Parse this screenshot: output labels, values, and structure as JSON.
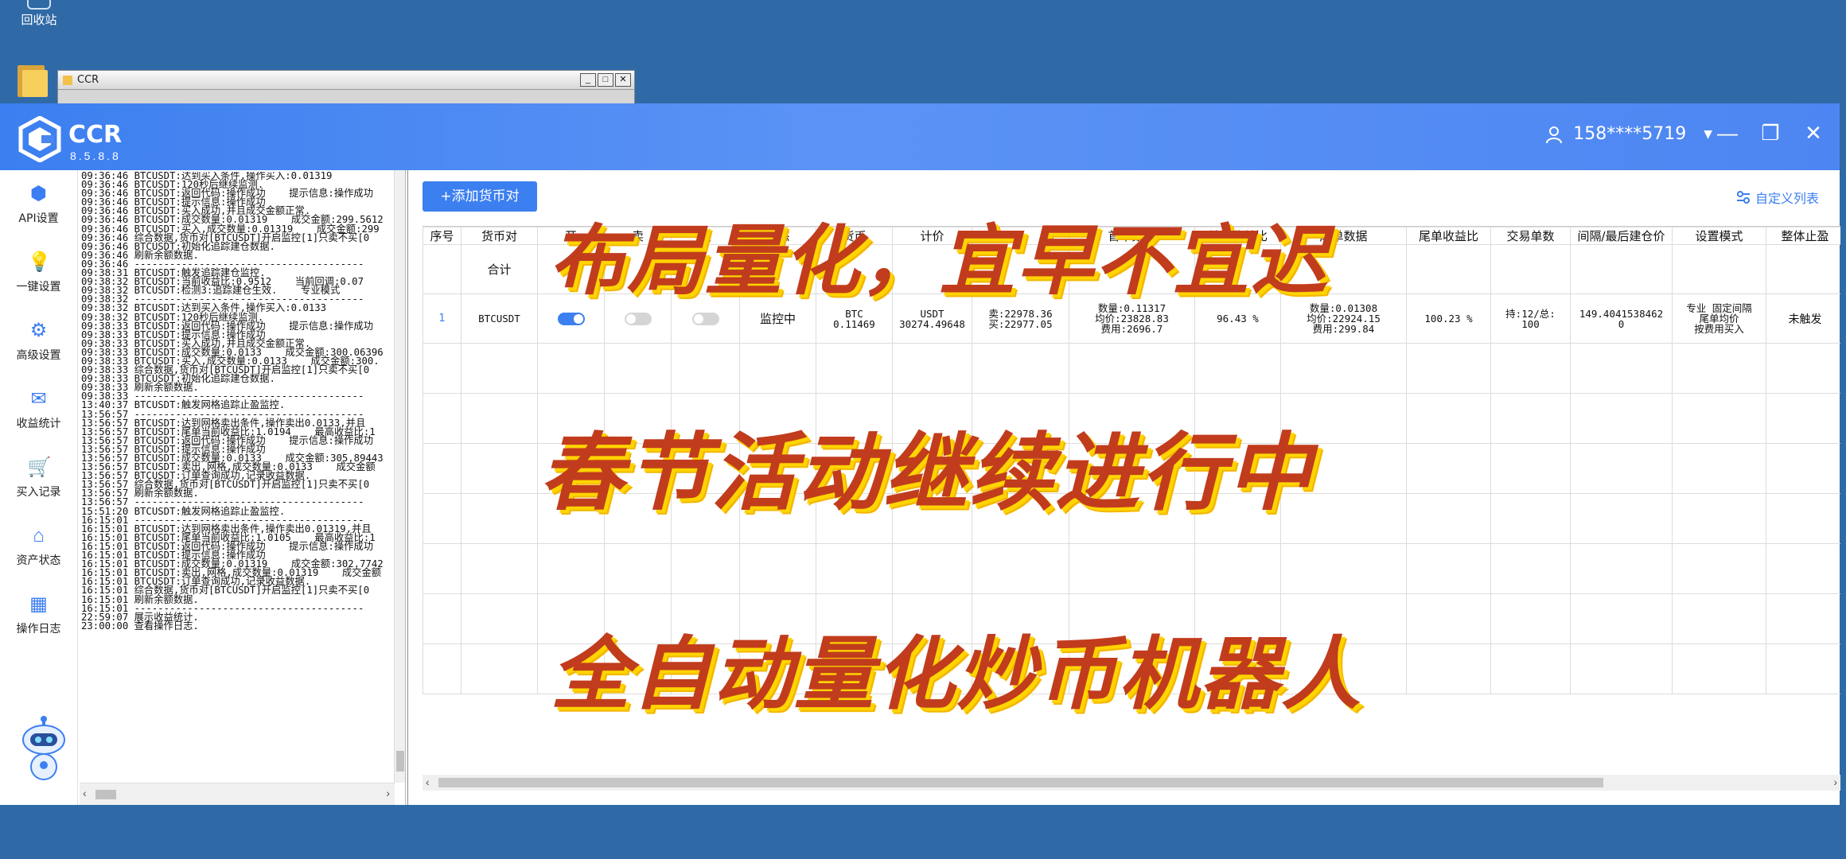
{
  "desktop": {
    "recycle_bin_label": "回收站",
    "bg_window_title": "CCR"
  },
  "app": {
    "name": "CCR",
    "version": "8.5.8.8",
    "user": "158****5719"
  },
  "sidebar": {
    "items": [
      {
        "label": "API设置",
        "icon": "shield-icon"
      },
      {
        "label": "一键设置",
        "icon": "bulb-icon"
      },
      {
        "label": "高级设置",
        "icon": "gear-icon"
      },
      {
        "label": "收益统计",
        "icon": "envelope-icon"
      },
      {
        "label": "买入记录",
        "icon": "cart-icon"
      },
      {
        "label": "资产状态",
        "icon": "home-icon"
      },
      {
        "label": "操作日志",
        "icon": "log-icon"
      }
    ]
  },
  "log_lines": [
    "09:36:46 BTCUSDT:达到买入条件,操作买入:0.01319",
    "09:36:46 BTCUSDT:120秒后继续监测.",
    "09:36:46 BTCUSDT:返回代码:操作成功    提示信息:操作成功",
    "09:36:46 BTCUSDT:提示信息:操作成功",
    "09:36:46 BTCUSDT:买入成功,并且成交金额正常.",
    "09:36:46 BTCUSDT:成交数量:0.01319    成交金额:299.5612",
    "09:36:46 BTCUSDT:买入,成交数量:0.01319    成交金额:299",
    "09:36:46 综合数据,货币对[BTCUSDT]开启监控[1]只卖不买[0",
    "09:36:46 BTCUSDT:初始化追踪建仓数据.",
    "09:36:46 刷新余额数据.",
    "09:36:46 ---------------------------------------",
    "09:38:31 BTCUSDT:触发追踪建仓监控.",
    "09:38:32 BTCUSDT:当前收益比:0.9512    当前回调:0.07",
    "09:38:32 BTCUSDT:检测3:追踪建仓生效.    专业模式",
    "09:38:32 ---------------------------------------",
    "09:38:32 BTCUSDT:达到买入条件,操作买入:0.0133",
    "09:38:32 BTCUSDT:120秒后继续监测.",
    "09:38:33 BTCUSDT:返回代码:操作成功    提示信息:操作成功",
    "09:38:33 BTCUSDT:提示信息:操作成功",
    "09:38:33 BTCUSDT:买入成功,并且成交金额正常.",
    "09:38:33 BTCUSDT:成交数量:0.0133    成交金额:300.06396",
    "09:38:33 BTCUSDT:买入,成交数量:0.0133    成交金额:300.",
    "09:38:33 综合数据,货币对[BTCUSDT]开启监控[1]只卖不买[0",
    "09:38:33 BTCUSDT:初始化追踪建仓数据.",
    "09:38:33 刷新余额数据.",
    "09:38:33 ---------------------------------------",
    "13:40:37 BTCUSDT:触发网格追踪止盈监控.",
    "13:56:57 ---------------------------------------",
    "13:56:57 BTCUSDT:达到网格卖出条件,操作卖出0.0133,并且",
    "13:56:57 BTCUSDT:尾单当前收益比:1.0194    最高收益比:1",
    "13:56:57 BTCUSDT:返回代码:操作成功    提示信息:操作成功",
    "13:56:57 BTCUSDT:提示信息:操作成功",
    "13:56:57 BTCUSDT:成交数量:0.0133    成交金额:305.89443",
    "13:56:57 BTCUSDT:卖出,网格,成交数量:0.0133    成交金额",
    "13:56:57 BTCUSDT:订单查询成功,记录收益数据.",
    "13:56:57 综合数据,货币对[BTCUSDT]开启监控[1]只卖不买[0",
    "13:56:57 刷新余额数据.",
    "13:56:57 ---------------------------------------",
    "15:51:20 BTCUSDT:触发网格追踪止盈监控.",
    "16:15:01 ---------------------------------------",
    "16:15:01 BTCUSDT:达到网格卖出条件,操作卖出0.01319,并且",
    "16:15:01 BTCUSDT:尾单当前收益比:1.0105    最高收益比:1",
    "16:15:01 BTCUSDT:返回代码:操作成功    提示信息:操作成功",
    "16:15:01 BTCUSDT:提示信息:操作成功",
    "16:15:01 BTCUSDT:成交数量:0.01319    成交金额:302.7742",
    "16:15:01 BTCUSDT:卖出,网格,成交数量:0.01319    成交金额",
    "16:15:01 BTCUSDT:订单查询成功,记录收益数据.",
    "16:15:01 综合数据,货币对[BTCUSDT]开启监控[1]只卖不买[0",
    "16:15:01 刷新余额数据.",
    "16:15:01 ---------------------------------------",
    "22:59:07 展示收益统计.",
    "23:00:00 查看操作日志."
  ],
  "toolbar": {
    "add_pair_label": "+添加货币对",
    "custom_list_label": "自定义列表"
  },
  "table": {
    "headers": [
      "序号",
      "货币对",
      "开",
      "卖",
      "模",
      "状态",
      "货币",
      "计价",
      "",
      "首单数据",
      "首单收益比",
      "尾单数据",
      "尾单收益比",
      "交易单数",
      "间隔/最后建仓价",
      "设置模式",
      "整体止盈"
    ],
    "total_label": "合计",
    "row": {
      "index": "1",
      "pair": "BTCUSDT",
      "status": "监控中",
      "coin": "BTC\n0.11469",
      "quote": "USDT\n30274.49648",
      "price": "卖:22978.36\n买:22977.05",
      "first_data": "数量:0.11317\n均价:23828.83\n费用:2696.7",
      "first_ratio": "96.43 %",
      "last_data": "数量:0.01308\n均价:22924.15\n费用:299.84",
      "last_ratio": "100.23 %",
      "orders": "持:12/总:\n100",
      "interval": "149.4041538462\n0",
      "mode": "专业 固定间隔\n尾单均价\n按费用买入",
      "take_profit": "未触发"
    }
  },
  "promo": {
    "line1": "布局量化，宜早不宜迟",
    "line2": "春节活动继续进行中",
    "line3": "全自动量化炒币机器人"
  }
}
